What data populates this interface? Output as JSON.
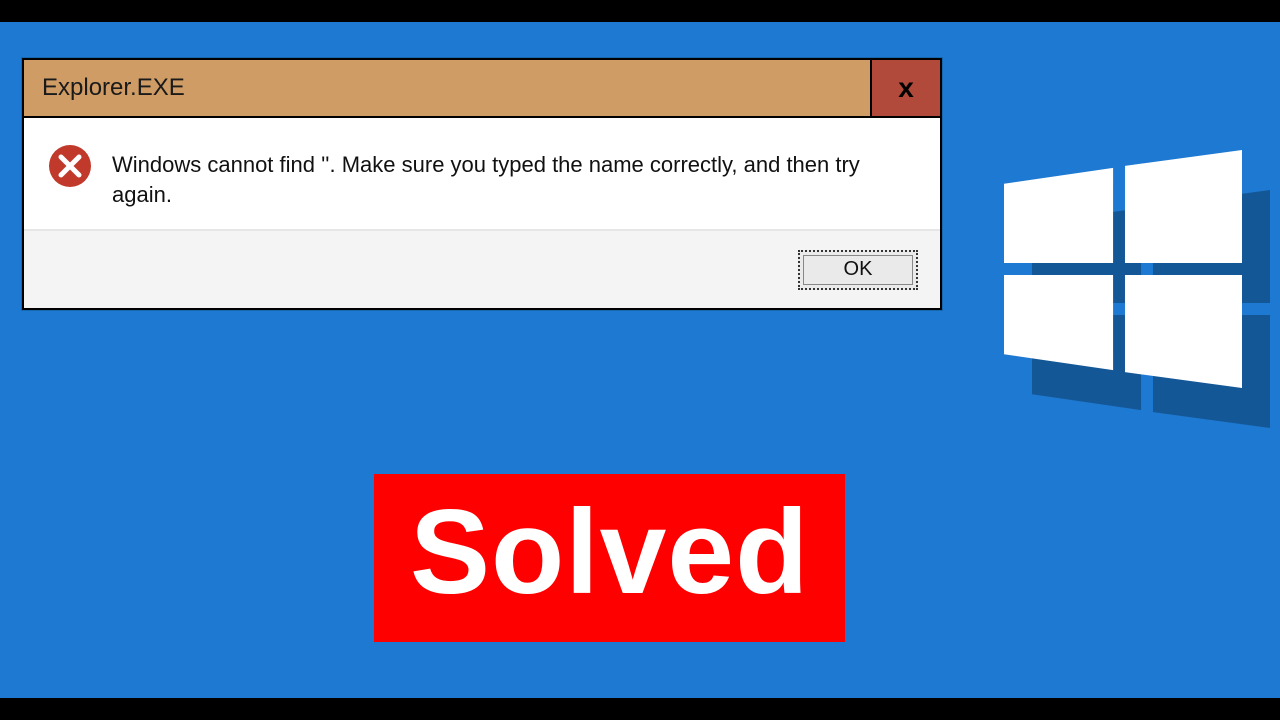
{
  "dialog": {
    "title": "Explorer.EXE",
    "close_glyph": "x",
    "message": "Windows cannot find ''. Make sure you typed the name correctly, and then try again.",
    "ok_label": "OK"
  },
  "overlay": {
    "solved_label": "Solved"
  },
  "colors": {
    "background": "#1d79d1",
    "titlebar": "#cf9c66",
    "close": "#b24a3b",
    "solved_bg": "#ff0000"
  }
}
